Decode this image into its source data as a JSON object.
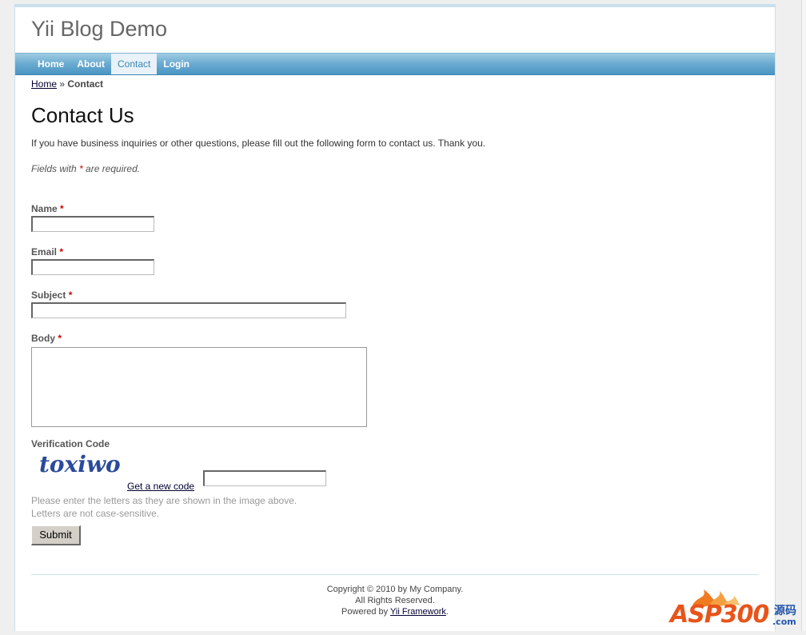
{
  "site": {
    "title": "Yii Blog Demo"
  },
  "menu": [
    {
      "label": "Home"
    },
    {
      "label": "About"
    },
    {
      "label": "Contact"
    },
    {
      "label": "Login"
    }
  ],
  "breadcrumbs": {
    "home": "Home",
    "separator": "»",
    "current": "Contact"
  },
  "page": {
    "heading": "Contact Us",
    "intro": "If you have business inquiries or other questions, please fill out the following form to contact us. Thank you.",
    "required_note_prefix": "Fields with ",
    "required_star": "*",
    "required_note_suffix": " are required."
  },
  "form": {
    "name_label": "Name",
    "email_label": "Email",
    "subject_label": "Subject",
    "body_label": "Body",
    "verification_label": "Verification Code",
    "captcha_text": "toxiwo",
    "new_code_link": "Get a new code",
    "hint_line1": "Please enter the letters as they are shown in the image above.",
    "hint_line2": "Letters are not case-sensitive.",
    "submit_label": "Submit",
    "name_value": "",
    "email_value": "",
    "subject_value": "",
    "body_value": "",
    "verify_value": ""
  },
  "footer": {
    "copyright": "Copyright © 2010 by My Company.",
    "rights": "All Rights Reserved.",
    "powered_prefix": "Powered by ",
    "powered_link": "Yii Framework",
    "powered_suffix": "."
  },
  "watermark": {
    "brand": "ASP300",
    "cjk": "源码",
    "domain": ".com"
  },
  "colors": {
    "menu_blue": "#4a95c3",
    "required_red": "#cc0000",
    "border_blue": "#c9e0ed"
  }
}
